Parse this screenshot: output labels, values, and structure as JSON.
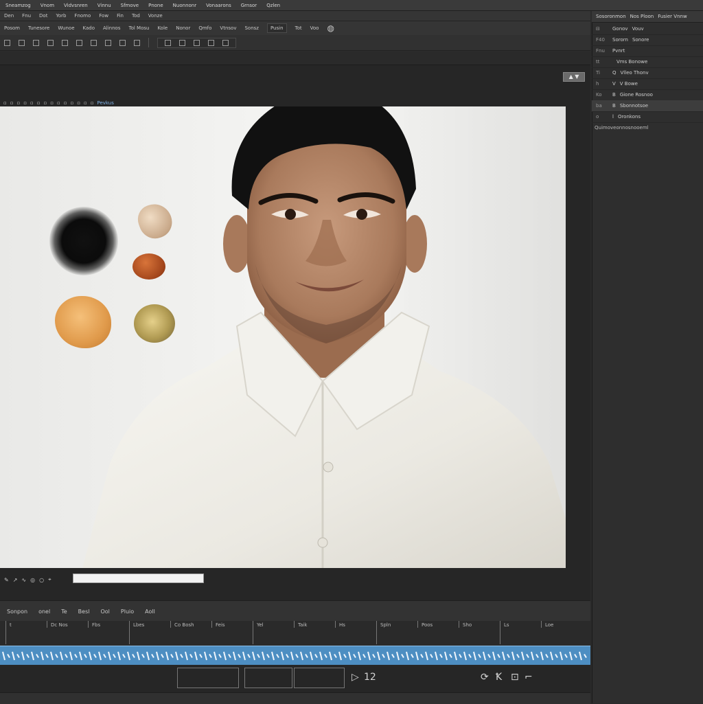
{
  "menu": {
    "items": [
      "Sneamzog",
      "Vnom",
      "Vidvsnren",
      "Vinnu",
      "Sfmove",
      "Pnone",
      "Nuonnonr",
      "Vonaarons",
      "Grnsor",
      "Qzlen"
    ]
  },
  "toolbar1": {
    "items": [
      "Den",
      "Fnu",
      "Dot",
      "Yorb",
      "Fnomo",
      "Fow",
      "Fin",
      "Tod",
      "Vonze"
    ]
  },
  "toolbar2": {
    "items": [
      "Posom",
      "Tunesore",
      "Wunoe",
      "Kado",
      "Alinnos",
      "Tol Mosu",
      "Kole",
      "Nonor",
      "Qmfo",
      "Vtnsov",
      "Sonsz"
    ],
    "zoom": "Pusin",
    "arrow_a": "Tot",
    "arrow_b": "Voo"
  },
  "viewer": {
    "control_label": "▲ ▼",
    "tool_label": "Pevkus",
    "footer_icons": [
      "✎",
      "↗",
      "∿",
      "◎",
      "○",
      "⌖"
    ]
  },
  "timeline": {
    "bar_items": [
      "Sonpon",
      "onel",
      "Te",
      "Besl",
      "Ool",
      "Pluio",
      "Aoll"
    ],
    "ruler_labels": [
      "t",
      "Dc Nos",
      "Fbs",
      "Lbes",
      "Co Bosh",
      "Feis",
      "Yel",
      "Taik",
      "Hs",
      "Spln",
      "Poos",
      "Sho",
      "Ls",
      "Loe"
    ],
    "frame": "12",
    "transport_icons": [
      "⟳",
      "Ꝁ",
      "⊡",
      "⌐"
    ]
  },
  "panel": {
    "tabs": [
      "Sosoronmon",
      "Nos Ploon",
      "Fusier Vnnw"
    ],
    "rows": [
      {
        "a": "⊟",
        "b": "Gonov",
        "c": "Vouv"
      },
      {
        "a": "F40",
        "b": "Sororn",
        "c": "Sonore"
      },
      {
        "a": "Fnu",
        "b": "Pvnrt",
        "c": ""
      },
      {
        "a": "tt",
        "b": "",
        "c": "Vms Bonowe"
      },
      {
        "a": "Ti",
        "b": "Q",
        "c": "Vlleo Thonv"
      },
      {
        "a": "h",
        "b": "V",
        "c": "V Bowe"
      },
      {
        "a": "Ko",
        "b": "B",
        "c": "Gione Rosnoo"
      },
      {
        "a": "ba",
        "b": "B",
        "c": "Sbonnotsoe"
      },
      {
        "a": "o",
        "b": "l",
        "c": "Oronkons"
      }
    ],
    "footer": "Quimoveonnosnooeml"
  }
}
